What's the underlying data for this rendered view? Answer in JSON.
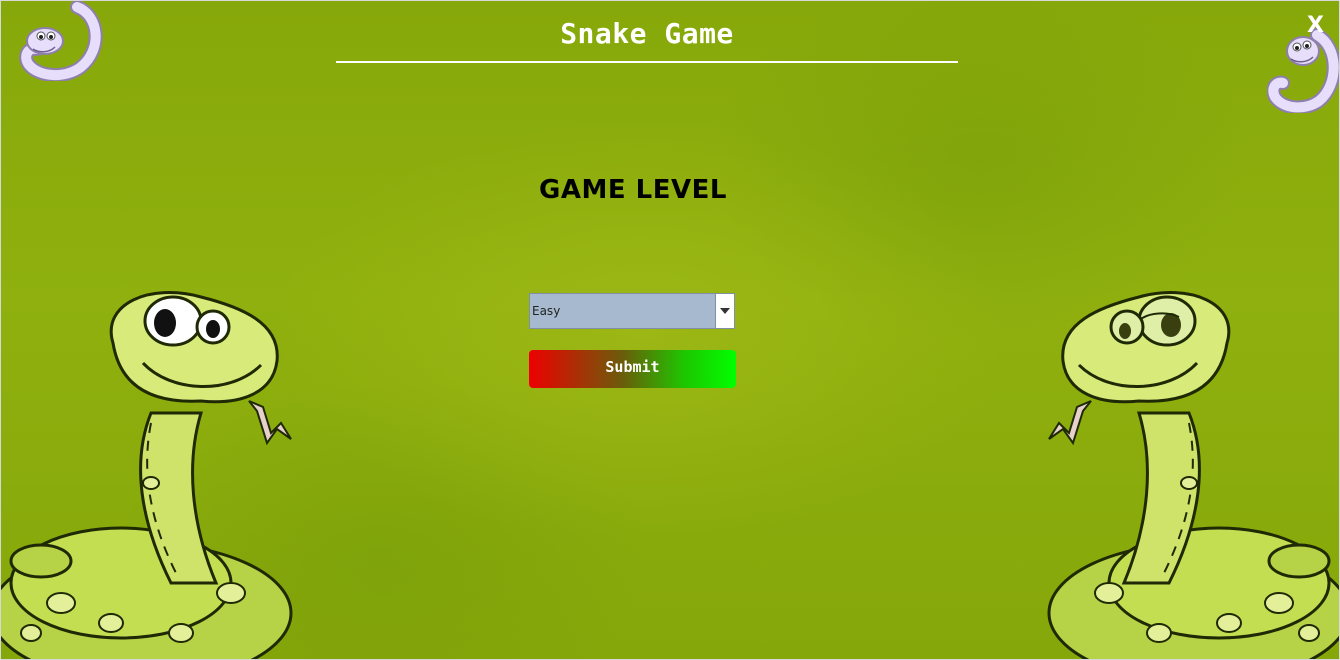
{
  "window": {
    "title": "Snake Game",
    "close_label": "X"
  },
  "level": {
    "heading": "GAME LEVEL",
    "selected": "Easy"
  },
  "submit_label": "Submit",
  "icons": {
    "top_left": "small-purple-snake-icon",
    "top_right": "small-purple-snake-icon",
    "left": "cartoon-green-snake",
    "right": "cartoon-green-snake"
  },
  "colors": {
    "background": "#8fb00e",
    "title_text": "#ffffff",
    "select_bg": "#a7b9cf",
    "submit_gradient_start": "#ee0000",
    "submit_gradient_end": "#00ff00"
  }
}
